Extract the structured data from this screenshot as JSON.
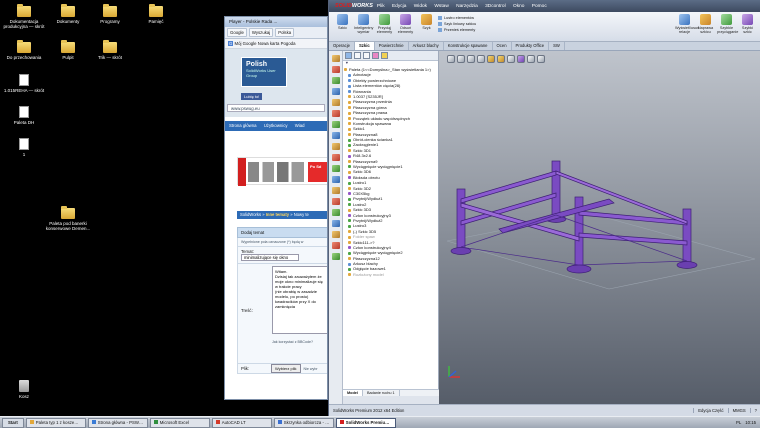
{
  "desktop": {
    "icons": [
      {
        "label": "Dokumentacja produkcyjna — skrót",
        "type": "folder"
      },
      {
        "label": "Dokumenty",
        "type": "folder"
      },
      {
        "label": "Programy",
        "type": "folder"
      },
      {
        "label": "Pamięć",
        "type": "folder"
      },
      {
        "label": "Do przechowania",
        "type": "folder"
      },
      {
        "label": "Pulpit",
        "type": "folder"
      },
      {
        "label": "Trik — skrót",
        "type": "folder"
      },
      {
        "label": "1.015REHA — skrót",
        "type": "doc"
      },
      {
        "label": "Paleta DH",
        "type": "doc"
      },
      {
        "label": "1",
        "type": "doc"
      },
      {
        "label": "Paleta pod banerki konserwowe Demen...",
        "type": "folder"
      },
      {
        "label": "Kosz",
        "type": "trash"
      }
    ]
  },
  "browser": {
    "title": "Player - Polskie Rada ...",
    "toolbar": [
      "Google",
      "Wyszukaj",
      "Polska"
    ],
    "bookmark_google": "G",
    "bookmarks": "Mój Google    Nowa karta    Pogoda",
    "logo_title": "Polish",
    "logo_sub": "SolidWorks User Group",
    "like_button": "Lubię to!",
    "url": "www.pswug.eu",
    "nav": [
      "Strona główna",
      "Użytkownicy",
      "Wiad"
    ],
    "ad_tag": "Po Sd",
    "forum_bar_prefix": "SolidWorks » ",
    "forum_bar_link": "Inne tematy",
    "forum_bar_suffix": " » Nowy te",
    "form": {
      "header": "Dodaj temat",
      "notice": "Wypełnione pola oznaczone (*) będą w",
      "subject_label": "Temat:",
      "subject_value": "minimalizujące się okno",
      "body_label": "Treść:",
      "body_value": "Witam.\nDzisiaj tak zauważyłem że moje okno minimalizuje się w trakcie pracy\n(nie obrabię w zasadzie modelu, po prostu)\nkwadracików przy X do zamknięcia",
      "hint": "Jak korzystać z BBCode?",
      "file_label": "Plik:",
      "file_button": "Wybierz plik",
      "file_none": "Nie wybr"
    }
  },
  "solidworks": {
    "brand": "SOLID",
    "brand_suffix": "WORKS",
    "menu": [
      "Plik",
      "Edycja",
      "Widok",
      "Wstaw",
      "Narzędzia",
      "3Dcontrol",
      "Okno",
      "Pomoc"
    ],
    "ribbon": [
      {
        "label": "Szkic",
        "color": "blue"
      },
      {
        "label": "Inteligentny wymiar",
        "color": "blue"
      },
      {
        "label": "Przyciąj elementy",
        "color": "green"
      },
      {
        "label": "Odsuń elementy",
        "color": "purple"
      },
      {
        "label": "Szyk",
        "color": "orange"
      }
    ],
    "ribbon_right": [
      "Lustro elementów",
      "Szyk liniowy szkicu",
      "Przenieś elementy"
    ],
    "ribbon_far": [
      {
        "label": "Wyświetl/usuń relacje",
        "color": "blue"
      },
      {
        "label": "Naprawa szkicu",
        "color": "orange"
      },
      {
        "label": "Szybkie przyciąganie",
        "color": "green"
      },
      {
        "label": "Szybki szkic",
        "color": "purple"
      }
    ],
    "tabs": [
      "Operacje",
      "Szkic",
      "Powierzchnie",
      "Arkusz blachy",
      "Konstrukcje spawane",
      "Ocen",
      "Produkty Office",
      "SW"
    ],
    "active_tab": "Szkic",
    "tree_filter": "▼",
    "tree": [
      {
        "label": "Paleta  (1<<Domyślna>_Stan wyświetlania 1>)",
        "type": "root"
      },
      {
        "label": "Adnotacje",
        "type": "blue"
      },
      {
        "label": "Obiekty powierzchniowe",
        "type": "blue"
      },
      {
        "label": "Lista elementów cięcia(28)",
        "type": "blue"
      },
      {
        "label": "Równania",
        "type": "blue"
      },
      {
        "label": "1.0037 [S235JR]",
        "type": "normal"
      },
      {
        "label": "Płaszczyzna przednia",
        "type": "normal"
      },
      {
        "label": "Płaszczyzna górna",
        "type": "normal"
      },
      {
        "label": "Płaszczyzna prawa",
        "type": "normal"
      },
      {
        "label": "Początek układu współrzędnych",
        "type": "normal"
      },
      {
        "label": "Konstrukcja spawana",
        "type": "normal"
      },
      {
        "label": "Szkic1",
        "type": "normal"
      },
      {
        "label": "Płaszczyzna8",
        "type": "normal"
      },
      {
        "label": "Obrót-cienka ścianka1",
        "type": "green"
      },
      {
        "label": "Zaokrąglenie1",
        "type": "green"
      },
      {
        "label": "Szkic 3D1",
        "type": "normal"
      },
      {
        "label": "R48.3x2.6",
        "type": "purple"
      },
      {
        "label": "Płaszczyzna9",
        "type": "normal"
      },
      {
        "label": "Wyciągnięcie wyciągnięcie1",
        "type": "green"
      },
      {
        "label": "Szkic 3D6",
        "type": "normal"
      },
      {
        "label": "Błoksda obrotu",
        "type": "purple"
      },
      {
        "label": "Lustro1",
        "type": "green"
      },
      {
        "label": "Szkic 3D2",
        "type": "normal"
      },
      {
        "label": "C30X5kg",
        "type": "purple"
      },
      {
        "label": "Przytnij/Wydłuż1",
        "type": "green"
      },
      {
        "label": "Lustro2",
        "type": "green"
      },
      {
        "label": "Szkic 3D3",
        "type": "normal"
      },
      {
        "label": "Człon konstrukcyjny3",
        "type": "purple"
      },
      {
        "label": "Przytnij/Wydłuż2",
        "type": "green"
      },
      {
        "label": "Lustro3",
        "type": "green"
      },
      {
        "label": "(-) Szkic 3D5",
        "type": "normal"
      },
      {
        "label": "Folder spaw",
        "type": "gray"
      },
      {
        "label": "Szkic111->?",
        "type": "normal"
      },
      {
        "label": "Człon konstrukcyjny4",
        "type": "purple"
      },
      {
        "label": "Wyciągnięcie wyciągnięcie2",
        "type": "green"
      },
      {
        "label": "Płaszczyzna12",
        "type": "normal"
      },
      {
        "label": "Arkusz blachy",
        "type": "blue"
      },
      {
        "label": "Odgięcie bazowe1",
        "type": "green"
      },
      {
        "label": "Rozłożony model",
        "type": "gray"
      }
    ],
    "tree_tabs": [
      "Model",
      "Badanie ruchu 1"
    ],
    "status_left": "SolidWorks Premium 2012 x64 Edition",
    "status_cells": [
      "Edycja Część",
      "MMGS",
      "?"
    ]
  },
  "taskbar": {
    "start": "Start",
    "items": [
      {
        "label": "Paleta typ 1 z koszem na...",
        "color": "#e2a83a"
      },
      {
        "label": "Strona główna - PSWUG...",
        "color": "#3a7bd5"
      },
      {
        "label": "Microsoft Excel",
        "color": "#2f8f3e"
      },
      {
        "label": "AutoCAD LT",
        "color": "#d43a2a"
      },
      {
        "label": "Skrzynka odbiorcza - Mic...",
        "color": "#3a6fd0"
      },
      {
        "label": "SolidWorks Premium ...",
        "color": "#d41f1f"
      }
    ],
    "active_index": 5,
    "lang": "PL",
    "clock": "10:15"
  },
  "colors": {
    "pallet_purple": "#7a4bc2",
    "viewport_top": "#bfc4cc",
    "viewport_bottom": "#565d69",
    "sw_red": "#e31b1b"
  }
}
